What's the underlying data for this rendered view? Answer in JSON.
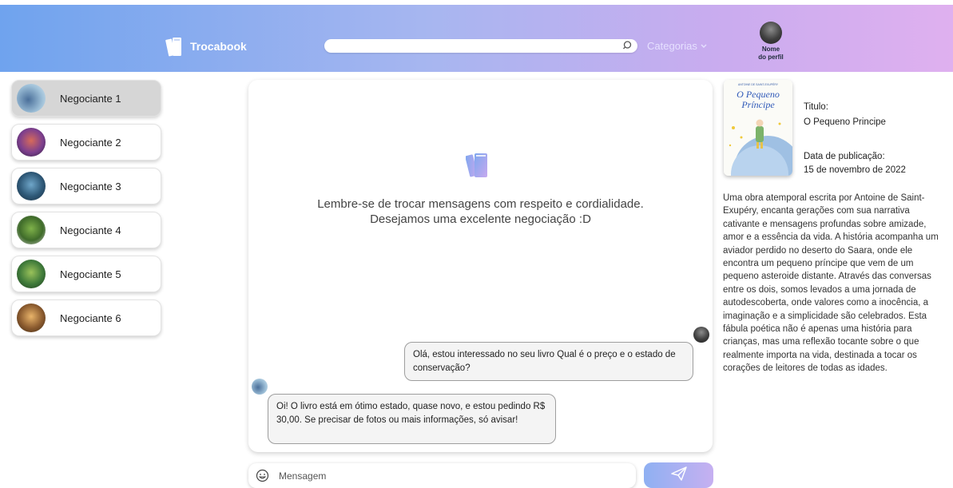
{
  "header": {
    "brand": "Trocabook",
    "search_placeholder": "",
    "categories_label": "Categorias",
    "profile_name": "Nome do perfil"
  },
  "sidebar": {
    "contacts": [
      {
        "name": "Negociante 1",
        "active": true
      },
      {
        "name": "Negociante 2",
        "active": false
      },
      {
        "name": "Negociante 3",
        "active": false
      },
      {
        "name": "Negociante 4",
        "active": false
      },
      {
        "name": "Negociante 5",
        "active": false
      },
      {
        "name": "Negociante 6",
        "active": false
      }
    ]
  },
  "chat": {
    "notice_line1": "Lembre-se de trocar mensagens com respeito e cordialidade.",
    "notice_line2": "Desejamos uma excelente negociação :D",
    "messages": [
      {
        "from": "me",
        "text": "Olá, estou interessado no seu livro Qual é o preço e o estado de conservação?"
      },
      {
        "from": "negociante",
        "text": "Oi! O livro está em ótimo estado, quase novo, e estou pedindo R$ 30,00. Se precisar de fotos ou mais informações, só avisar!"
      }
    ],
    "input_placeholder": "Mensagem"
  },
  "book": {
    "cover_author": "ANTOINE DE SAINT-EXUPÉRY",
    "cover_title_line1": "O Pequeno",
    "cover_title_line2": "Príncipe",
    "title_label": "Titulo:",
    "title_value": "O Pequeno Principe",
    "date_label": "Data de publicação:",
    "date_value": "15 de novembro de 2022",
    "description": "Uma obra atemporal escrita por Antoine de Saint-Exupéry, encanta gerações com sua narrativa cativante e mensagens profundas sobre amizade, amor e a essência da vida. A história acompanha um aviador perdido no deserto do Saara, onde ele encontra um pequeno príncipe que vem de um pequeno asteroide distante. Através das conversas entre os dois, somos levados a uma jornada de autodescoberta, onde valores como a inocência, a imaginação e a simplicidade são celebrados. Esta fábula poética não é apenas uma história para crianças, mas uma reflexão tocante sobre o que realmente importa na vida, destinada a tocar os corações de leitores de todas as idades."
  },
  "icons": {
    "logo": "books-logo-icon",
    "search": "search-icon",
    "chevron": "chevron-down-icon",
    "emoji": "emoji-icon",
    "send": "send-icon"
  },
  "colors": {
    "header_start": "#6fa3ee",
    "header_end": "#dfb0ef",
    "active_contact": "#d6d6d6",
    "bubble_border": "#9e9e9e"
  }
}
